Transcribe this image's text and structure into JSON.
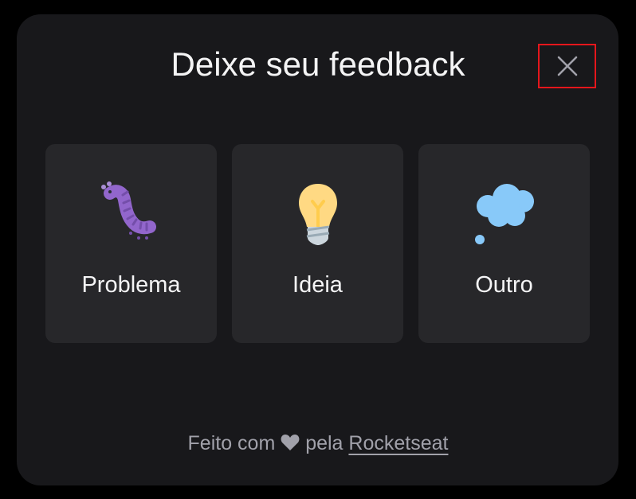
{
  "dialog": {
    "title": "Deixe seu feedback",
    "close_icon": "close-icon"
  },
  "options": [
    {
      "label": "Problema",
      "icon": "caterpillar-bug-icon"
    },
    {
      "label": "Ideia",
      "icon": "light-bulb-icon"
    },
    {
      "label": "Outro",
      "icon": "thought-balloon-icon"
    }
  ],
  "footer": {
    "prefix": "Feito com",
    "icon": "heart-icon",
    "middle": "pela",
    "link": "Rocketseat"
  },
  "colors": {
    "background": "#000000",
    "panel": "#18181b",
    "card": "#27272a",
    "highlight": "#e5161c"
  }
}
